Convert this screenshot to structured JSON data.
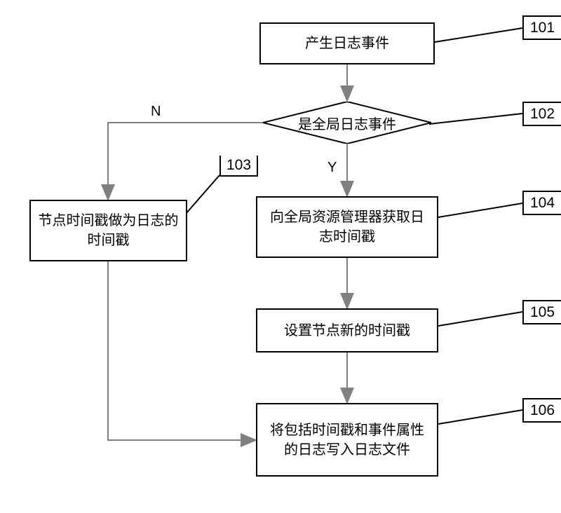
{
  "chart_data": {
    "type": "flowchart",
    "nodes": [
      {
        "id": "101",
        "shape": "rect",
        "text": "产生日志事件"
      },
      {
        "id": "102",
        "shape": "diamond",
        "text": "是全局日志事件"
      },
      {
        "id": "103",
        "shape": "rect",
        "text": "节点时间戳做为日志的时间戳"
      },
      {
        "id": "104",
        "shape": "rect",
        "text": "向全局资源管理器获取日志时间戳"
      },
      {
        "id": "105",
        "shape": "rect",
        "text": "设置节点新的时间戳"
      },
      {
        "id": "106",
        "shape": "rect",
        "text": "将包括时间戳和事件属性的日志写入日志文件"
      }
    ],
    "edges": [
      {
        "from": "101",
        "to": "102",
        "label": ""
      },
      {
        "from": "102",
        "to": "103",
        "label": "N"
      },
      {
        "from": "102",
        "to": "104",
        "label": "Y"
      },
      {
        "from": "104",
        "to": "105",
        "label": ""
      },
      {
        "from": "105",
        "to": "106",
        "label": ""
      },
      {
        "from": "103",
        "to": "106",
        "label": ""
      }
    ]
  },
  "nodes": {
    "n101": {
      "text": "产生日志事件",
      "tag": "101"
    },
    "n102": {
      "text": "是全局日志事件",
      "tag": "102"
    },
    "n103": {
      "text": "节点时间戳做为日志的时间戳",
      "tag": "103"
    },
    "n104": {
      "text": "向全局资源管理器获取日志时间戳",
      "tag": "104"
    },
    "n105": {
      "text": "设置节点新的时间戳",
      "tag": "105"
    },
    "n106": {
      "text": "将包括时间戳和事件属性的日志写入日志文件",
      "tag": "106"
    }
  },
  "labels": {
    "no": "N",
    "yes": "Y"
  }
}
